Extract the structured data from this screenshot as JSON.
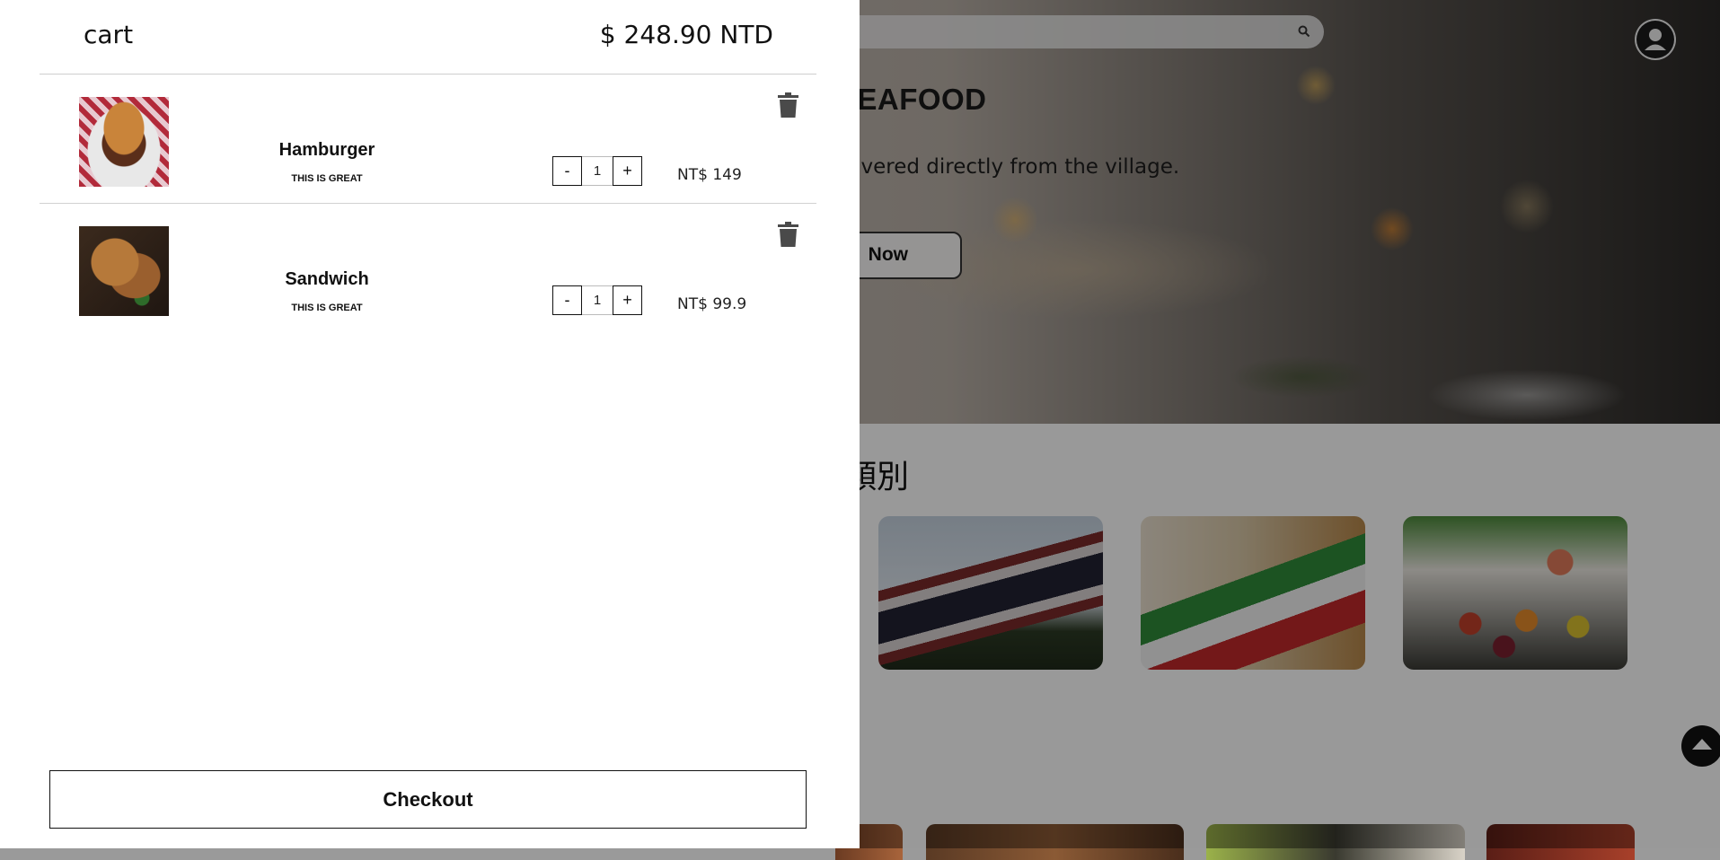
{
  "background_page": {
    "hero": {
      "title": "O SEAFOOD",
      "subtitle": "delivered directly from the village.",
      "button_label": "Now"
    },
    "section_title": "類別",
    "icons": {
      "search": "search-icon",
      "user": "user-avatar-icon",
      "scroll_top": "chevron-up-icon"
    }
  },
  "cart": {
    "title": "cart",
    "total": "$ 248.90 NTD",
    "items": [
      {
        "name": "Hamburger",
        "description": "THIS IS GREAT",
        "quantity": "1",
        "price": "NT$ 149",
        "decrement_label": "-",
        "increment_label": "+"
      },
      {
        "name": "Sandwich",
        "description": "THIS IS GREAT",
        "quantity": "1",
        "price": "NT$ 99.9",
        "decrement_label": "-",
        "increment_label": "+"
      }
    ],
    "checkout_label": "Checkout",
    "icons": {
      "remove": "trash-icon"
    }
  },
  "colors": {
    "overlay": "rgba(0,0,0,0.4)",
    "drawer_bg": "#ffffff",
    "text": "#111111"
  }
}
